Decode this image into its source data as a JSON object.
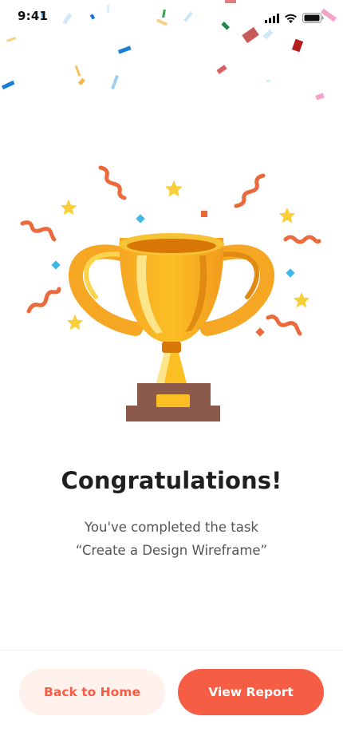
{
  "status_bar": {
    "time": "9:41"
  },
  "content": {
    "title": "Congratulations!",
    "subtitle_line1": "You've completed the task",
    "subtitle_line2": "“Create a Design Wireframe”"
  },
  "actions": {
    "back_label": "Back to Home",
    "report_label": "View Report"
  },
  "colors": {
    "accent": "#f65d45",
    "accent_light": "#fff1ec",
    "trophy_gold": "#fbbf24",
    "trophy_base": "#8b5a4a"
  },
  "icons": [
    "signal-icon",
    "wifi-icon",
    "battery-icon",
    "trophy-icon",
    "confetti",
    "star-icon"
  ]
}
